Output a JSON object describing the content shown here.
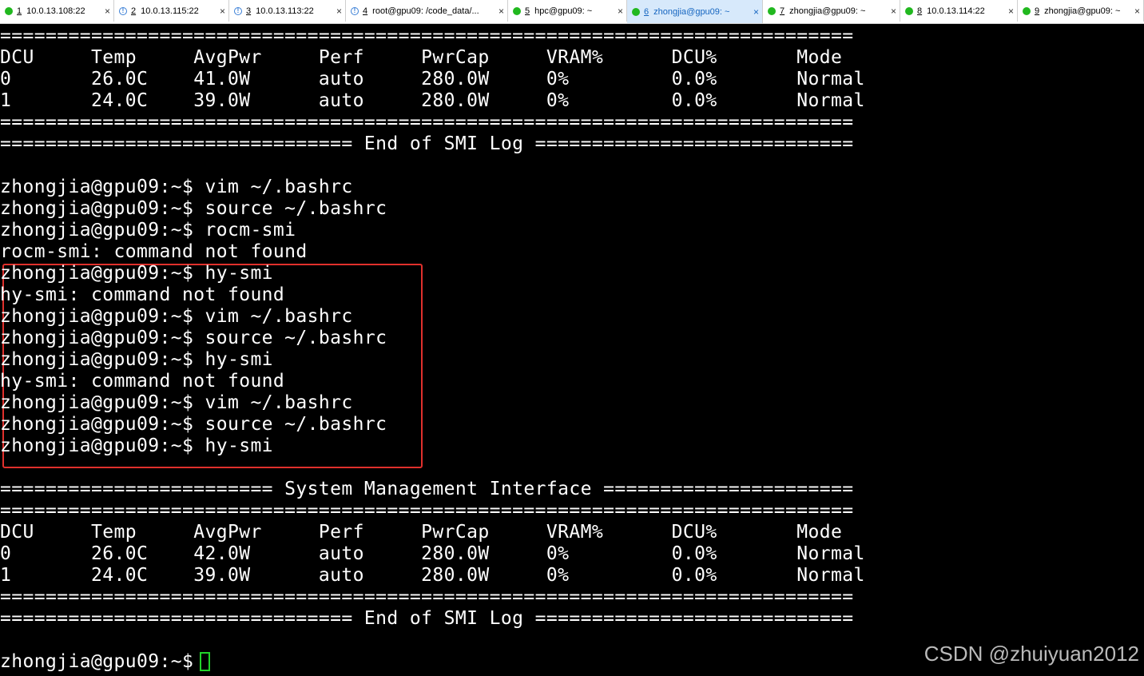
{
  "tabs": [
    {
      "num": "1",
      "title": " 10.0.13.108:22",
      "status": "ok",
      "active": false
    },
    {
      "num": "2",
      "title": " 10.0.13.115:22",
      "status": "warn",
      "active": false
    },
    {
      "num": "3",
      "title": " 10.0.13.113:22",
      "status": "warn",
      "active": false
    },
    {
      "num": "4",
      "title": " root@gpu09: /code_data/...",
      "status": "warn",
      "active": false
    },
    {
      "num": "5",
      "title": " hpc@gpu09: ~",
      "status": "ok",
      "active": false
    },
    {
      "num": "6",
      "title": " zhongjia@gpu09: ~",
      "status": "ok",
      "active": true
    },
    {
      "num": "7",
      "title": " zhongjia@gpu09: ~",
      "status": "ok",
      "active": false
    },
    {
      "num": "8",
      "title": " 10.0.13.114:22",
      "status": "ok",
      "active": false
    },
    {
      "num": "9",
      "title": " zhongjia@gpu09: ~",
      "status": "ok",
      "active": false
    }
  ],
  "close_glyph": "×",
  "terminal": {
    "lines": [
      "===========================================================================",
      "DCU     Temp     AvgPwr     Perf     PwrCap     VRAM%      DCU%       Mode",
      "0       26.0C    41.0W      auto     280.0W     0%         0.0%       Normal",
      "1       24.0C    39.0W      auto     280.0W     0%         0.0%       Normal",
      "===========================================================================",
      "=============================== End of SMI Log ============================",
      "",
      "zhongjia@gpu09:~$ vim ~/.bashrc",
      "zhongjia@gpu09:~$ source ~/.bashrc",
      "zhongjia@gpu09:~$ rocm-smi",
      "rocm-smi: command not found",
      "zhongjia@gpu09:~$ hy-smi",
      "hy-smi: command not found",
      "zhongjia@gpu09:~$ vim ~/.bashrc",
      "zhongjia@gpu09:~$ source ~/.bashrc",
      "zhongjia@gpu09:~$ hy-smi",
      "hy-smi: command not found",
      "zhongjia@gpu09:~$ vim ~/.bashrc",
      "zhongjia@gpu09:~$ source ~/.bashrc",
      "zhongjia@gpu09:~$ hy-smi",
      "",
      "======================== System Management Interface ======================",
      "===========================================================================",
      "DCU     Temp     AvgPwr     Perf     PwrCap     VRAM%      DCU%       Mode",
      "0       26.0C    42.0W      auto     280.0W     0%         0.0%       Normal",
      "1       24.0C    39.0W      auto     280.0W     0%         0.0%       Normal",
      "===========================================================================",
      "=============================== End of SMI Log ============================",
      "",
      "zhongjia@gpu09:~$ "
    ]
  },
  "watermark": "CSDN @zhuiyuan2012",
  "colors": {
    "tab_active_bg": "#d7e9fb",
    "tab_active_text": "#1565c0",
    "status_ok": "#21b81f",
    "highlight_border": "#e0302c",
    "cursor": "#22d32a"
  }
}
